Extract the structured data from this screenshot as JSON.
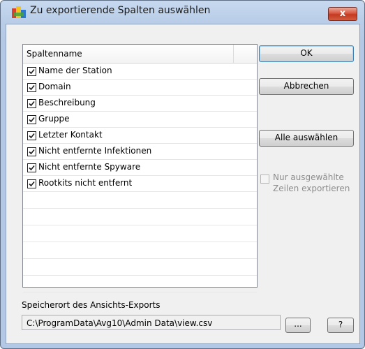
{
  "window": {
    "title": "Zu exportierende Spalten auswählen",
    "close_label": "x"
  },
  "list": {
    "header": "Spaltenname",
    "items": [
      {
        "label": "Name der Station",
        "checked": true
      },
      {
        "label": "Domain",
        "checked": true
      },
      {
        "label": "Beschreibung",
        "checked": true
      },
      {
        "label": "Gruppe",
        "checked": true
      },
      {
        "label": "Letzter Kontakt",
        "checked": true
      },
      {
        "label": "Nicht entfernte Infektionen",
        "checked": true
      },
      {
        "label": "Nicht entfernte Spyware",
        "checked": true
      },
      {
        "label": "Rootkits nicht entfernt",
        "checked": true
      }
    ]
  },
  "buttons": {
    "ok": "OK",
    "cancel": "Abbrechen",
    "select_all": "Alle auswählen",
    "browse": "...",
    "help": "?"
  },
  "export_selected": {
    "label": "Nur ausgewählte Zeilen exportieren",
    "checked": false,
    "enabled": false
  },
  "export_location": {
    "label": "Speicherort des Ansichts-Exports",
    "path": "C:\\ProgramData\\Avg10\\Admin Data\\view.csv"
  },
  "colors": {
    "title_bar": "#b9cde8",
    "close_button": "#c9452c",
    "dialog_bg": "#f0f0f0"
  }
}
